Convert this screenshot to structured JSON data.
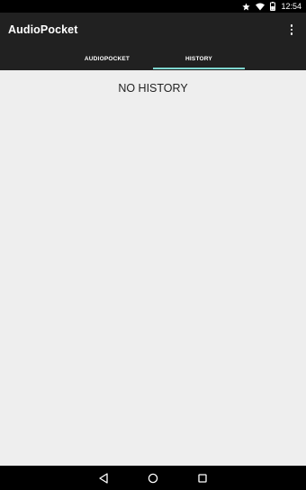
{
  "status_bar": {
    "time": "12:54",
    "icons": [
      "star-icon",
      "wifi-icon",
      "battery-icon"
    ]
  },
  "app_bar": {
    "title": "AudioPocket",
    "overflow_icon": "more-vert-icon"
  },
  "tabs": [
    {
      "label": "AUDIOPOCKET",
      "selected": false
    },
    {
      "label": "HISTORY",
      "selected": true
    }
  ],
  "main": {
    "empty_message": "NO HISTORY"
  },
  "nav_bar": {
    "icons": [
      "back-icon",
      "home-icon",
      "recents-icon"
    ]
  },
  "colors": {
    "toolbar": "#212121",
    "tab_indicator": "#7fd7d0",
    "background": "#eeeeee",
    "system_bars": "#000000"
  }
}
